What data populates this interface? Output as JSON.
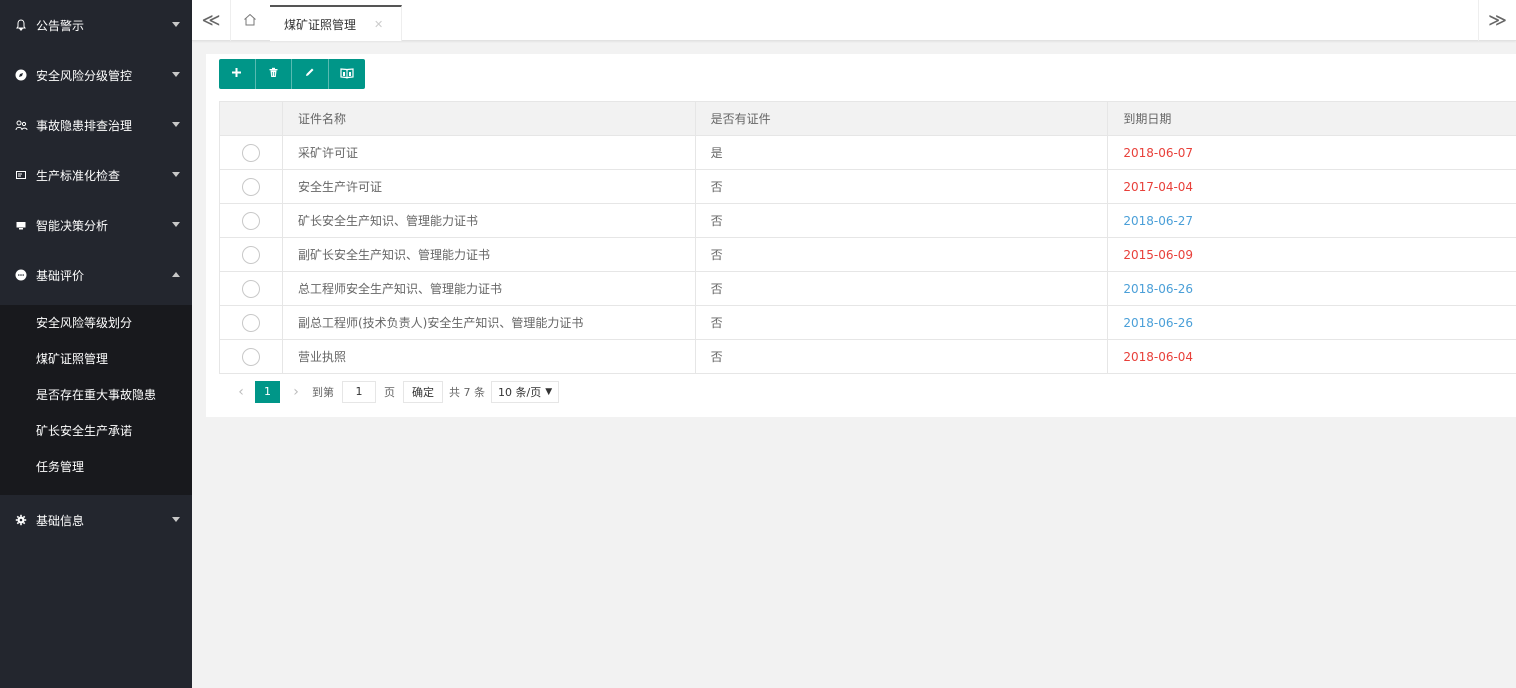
{
  "sidebar": {
    "items": [
      {
        "label": "公告警示",
        "icon": "bell-icon"
      },
      {
        "label": "安全风险分级管控",
        "icon": "compass-icon"
      },
      {
        "label": "事故隐患排查治理",
        "icon": "people-icon"
      },
      {
        "label": "生产标准化检查",
        "icon": "card-icon"
      },
      {
        "label": "智能决策分析",
        "icon": "monitor-icon"
      },
      {
        "label": "基础评价",
        "icon": "chat-icon"
      },
      {
        "label": "基础信息",
        "icon": "gear-icon"
      }
    ],
    "submenu": [
      "安全风险等级划分",
      "煤矿证照管理",
      "是否存在重大事故隐患",
      "矿长安全生产承诺",
      "任务管理"
    ]
  },
  "tabbar": {
    "prev_glyph": "≪",
    "next_glyph": "≫",
    "active_tab": "煤矿证照管理",
    "close_glyph": "✕"
  },
  "toolbar": {
    "add": "+",
    "buttons": [
      "add-icon",
      "trash-icon",
      "edit-icon",
      "book-icon"
    ]
  },
  "table": {
    "columns": [
      "",
      "证件名称",
      "是否有证件",
      "到期日期"
    ],
    "rows": [
      {
        "name": "采矿许可证",
        "has": "是",
        "date": "2018-06-07",
        "date_color": "red"
      },
      {
        "name": "安全生产许可证",
        "has": "否",
        "date": "2017-04-04",
        "date_color": "red"
      },
      {
        "name": "矿长安全生产知识、管理能力证书",
        "has": "否",
        "date": "2018-06-27",
        "date_color": "blue"
      },
      {
        "name": "副矿长安全生产知识、管理能力证书",
        "has": "否",
        "date": "2015-06-09",
        "date_color": "red"
      },
      {
        "name": "总工程师安全生产知识、管理能力证书",
        "has": "否",
        "date": "2018-06-26",
        "date_color": "blue"
      },
      {
        "name": "副总工程师(技术负责人)安全生产知识、管理能力证书",
        "has": "否",
        "date": "2018-06-26",
        "date_color": "blue"
      },
      {
        "name": "营业执照",
        "has": "否",
        "date": "2018-06-04",
        "date_color": "red"
      }
    ]
  },
  "pager": {
    "current": "1",
    "goto_label": "到第",
    "goto_value": "1",
    "page_unit": "页",
    "confirm": "确定",
    "total": "共 7 条",
    "page_size": "10 条/页"
  },
  "colors": {
    "sidebar_bg": "#23262e",
    "submenu_bg": "#18191d",
    "accent": "#009688",
    "date_red": "#e8403a",
    "date_blue": "#4a9fd8"
  }
}
